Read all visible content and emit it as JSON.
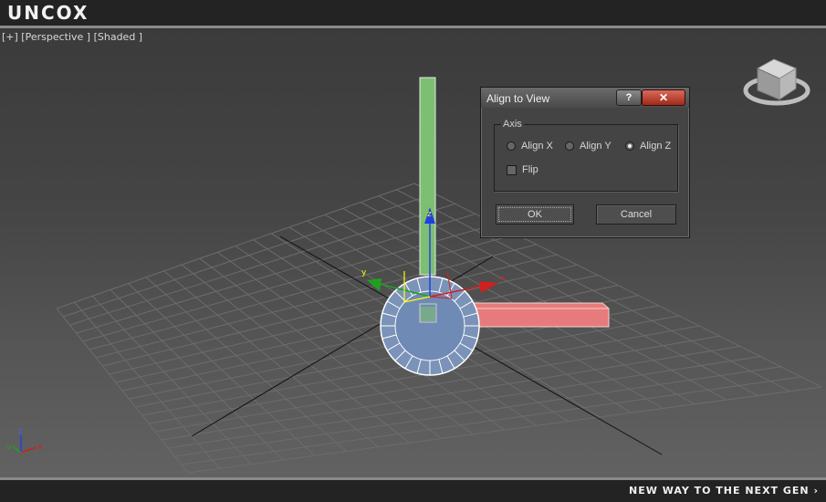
{
  "brand": {
    "logo": "UNCOX",
    "slogan": "NEW WAY TO THE NEXT GEN ›"
  },
  "viewport": {
    "label": "[+] [Perspective ] [Shaded ]"
  },
  "gizmo": {
    "x": "x",
    "y": "y",
    "z": "z"
  },
  "axis_tripod": {
    "x": "x",
    "y": "y",
    "z": "z"
  },
  "dialog": {
    "title": "Align to View",
    "help": "?",
    "close": "✕",
    "group_label": "Axis",
    "radios": [
      {
        "label": "Align X",
        "checked": false
      },
      {
        "label": "Align Y",
        "checked": false
      },
      {
        "label": "Align Z",
        "checked": true
      }
    ],
    "flip_label": "Flip",
    "flip_checked": false,
    "ok_label": "OK",
    "cancel_label": "Cancel"
  },
  "colors": {
    "x_axis": "#d02020",
    "y_axis": "#20a020",
    "z_axis": "#2040e0",
    "selection": "#ffff00",
    "object_fill": "#7b93b8",
    "green_box": "#7dbf72",
    "red_box": "#e77b7b"
  }
}
